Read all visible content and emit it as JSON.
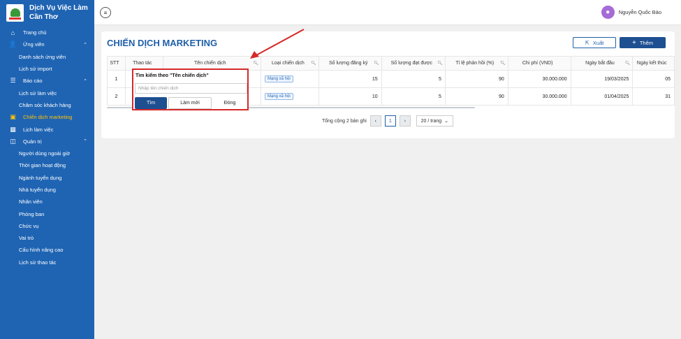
{
  "brand": {
    "line1": "Dịch Vụ Việc Làm",
    "line2": "Cần Thơ"
  },
  "sidebar": {
    "items": [
      {
        "label": "Trang chủ",
        "type": "top",
        "icon": "home-icon",
        "glyph": "⌂"
      },
      {
        "label": "Ứng viên",
        "type": "top",
        "icon": "user-icon",
        "glyph": "👤",
        "expanded": true
      },
      {
        "label": "Danh sách ứng viên",
        "type": "sub"
      },
      {
        "label": "Lịch sử import",
        "type": "sub"
      },
      {
        "label": "Báo cáo",
        "type": "top",
        "icon": "list-icon",
        "glyph": "☰",
        "expanded": true
      },
      {
        "label": "Lịch sử làm việc",
        "type": "sub"
      },
      {
        "label": "Chăm sóc khách hàng",
        "type": "sub"
      },
      {
        "label": "Chiến dịch marketing",
        "type": "top",
        "icon": "campaign-icon",
        "glyph": "▣",
        "active": true
      },
      {
        "label": "Lịch làm việc",
        "type": "top",
        "icon": "calendar-icon",
        "glyph": "▦"
      },
      {
        "label": "Quản trị",
        "type": "top",
        "icon": "admin-icon",
        "glyph": "◫",
        "expanded": true
      },
      {
        "label": "Người dùng ngoài giờ",
        "type": "sub"
      },
      {
        "label": "Thời gian hoạt động",
        "type": "sub"
      },
      {
        "label": "Ngành tuyển dụng",
        "type": "sub"
      },
      {
        "label": "Nhà tuyển dụng",
        "type": "sub"
      },
      {
        "label": "Nhân viên",
        "type": "sub"
      },
      {
        "label": "Phòng ban",
        "type": "sub"
      },
      {
        "label": "Chức vụ",
        "type": "sub"
      },
      {
        "label": "Vai trò",
        "type": "sub"
      },
      {
        "label": "Cấu hình nâng cao",
        "type": "sub"
      },
      {
        "label": "Lịch sử thao tác",
        "type": "sub"
      }
    ]
  },
  "header": {
    "user_name": "Nguyễn Quốc Bảo"
  },
  "main": {
    "title": "CHIẾN DỊCH MARKETING",
    "export_label": "Xuất",
    "add_label": "Thêm",
    "table": {
      "columns": [
        "STT",
        "Thao tác",
        "Tên chiến dịch",
        "Loại chiến dịch",
        "Số lượng đăng ký",
        "Số lượng đạt được",
        "Tỉ lệ phản hồi (%)",
        "Chi phí (VND)",
        "Ngày bắt đầu",
        "Ngày kết thúc"
      ],
      "rows": [
        {
          "stt": "1",
          "action": "",
          "name": "",
          "type": "Mạng xã hội",
          "registered": "15",
          "achieved": "5",
          "rate": "90",
          "cost": "30.000.000",
          "start": "19/03/2025",
          "end": "05"
        },
        {
          "stt": "2",
          "action": "",
          "name": "",
          "type": "Mạng xã hội",
          "registered": "10",
          "achieved": "5",
          "rate": "90",
          "cost": "30.000.000",
          "start": "01/04/2025",
          "end": "31"
        }
      ]
    },
    "pagination": {
      "total_text": "Tổng cộng 2 bản ghi",
      "current_page": "1",
      "page_size": "20 / trang",
      "prev": "‹",
      "next": "›"
    }
  },
  "search_popup": {
    "title": "Tìm kiếm theo \"Tên chiến dịch\"",
    "placeholder": "Nhập tên chiến dịch",
    "find_label": "Tìm",
    "reset_label": "Làm mới",
    "close_label": "Đóng"
  },
  "colors": {
    "sidebar": "#1f64b3",
    "accent": "#1d4f91",
    "active": "#ffc107",
    "highlight": "#d62929"
  }
}
